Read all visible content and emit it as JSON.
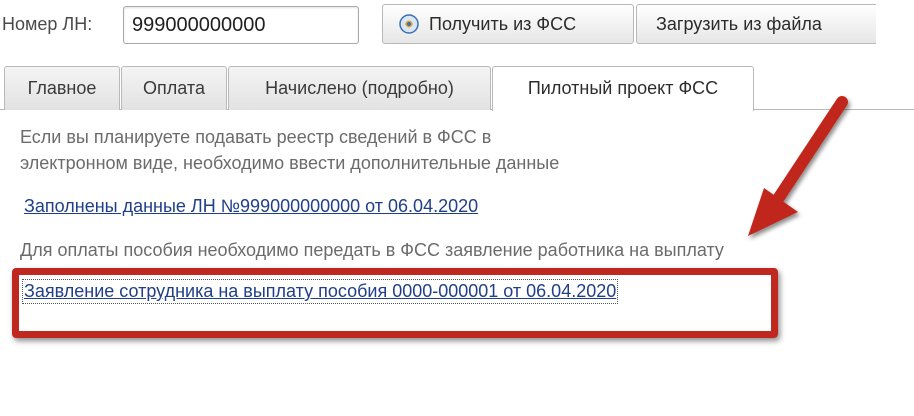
{
  "header": {
    "ln_label": "Номер ЛН:",
    "ln_value": "999000000000",
    "btn_fss": "Получить из ФСС",
    "btn_file": "Загрузить из файла"
  },
  "tabs": [
    {
      "label": "Главное",
      "active": false
    },
    {
      "label": "Оплата",
      "active": false
    },
    {
      "label": "Начислено (подробно)",
      "active": false
    },
    {
      "label": "Пилотный проект ФСС",
      "active": true
    }
  ],
  "content": {
    "info_line1": "Если вы планируете подавать реестр сведений в ФСС в",
    "info_line2": "электронном виде, необходимо ввести дополнительные данные",
    "link_ln": "Заполнены данные ЛН №999000000000 от 06.04.2020",
    "info_payment": "Для оплаты пособия необходимо передать в ФСС заявление работника на выплату",
    "link_application": "Заявление сотрудника на выплату пособия 0000-000001 от 06.04.2020"
  },
  "annotation": {
    "color": "#c0281f"
  }
}
